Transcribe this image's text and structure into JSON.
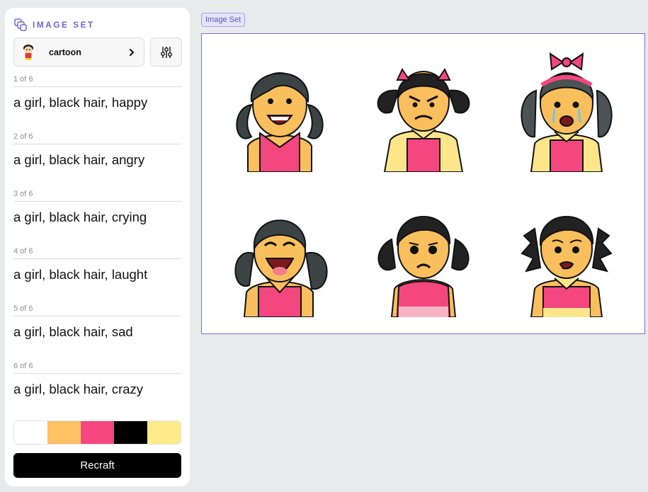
{
  "panel": {
    "header_title": "IMAGE SET",
    "style_name": "cartoon",
    "prompts": [
      {
        "count": "1 of 6",
        "text": "a girl, black hair, happy"
      },
      {
        "count": "2 of 6",
        "text": "a girl, black hair, angry"
      },
      {
        "count": "3 of 6",
        "text": "a girl, black hair, crying"
      },
      {
        "count": "4 of 6",
        "text": "a girl, black hair, laught"
      },
      {
        "count": "5 of 6",
        "text": "a girl, black hair, sad"
      },
      {
        "count": "6 of 6",
        "text": "a girl, black hair, crazy"
      }
    ],
    "palette": [
      "#ffffff",
      "#fcc264",
      "#f4467f",
      "#000000",
      "#fdeb8a"
    ],
    "generate_label": "Recraft"
  },
  "canvas": {
    "tag": "Image Set",
    "frame_color": "#7a72d6",
    "images": [
      "happy",
      "angry",
      "crying",
      "laughing",
      "sad",
      "crazy"
    ]
  },
  "icons": {
    "header": "image-set-icon",
    "style_chevron": "chevron-right-icon",
    "settings": "sliders-icon"
  }
}
